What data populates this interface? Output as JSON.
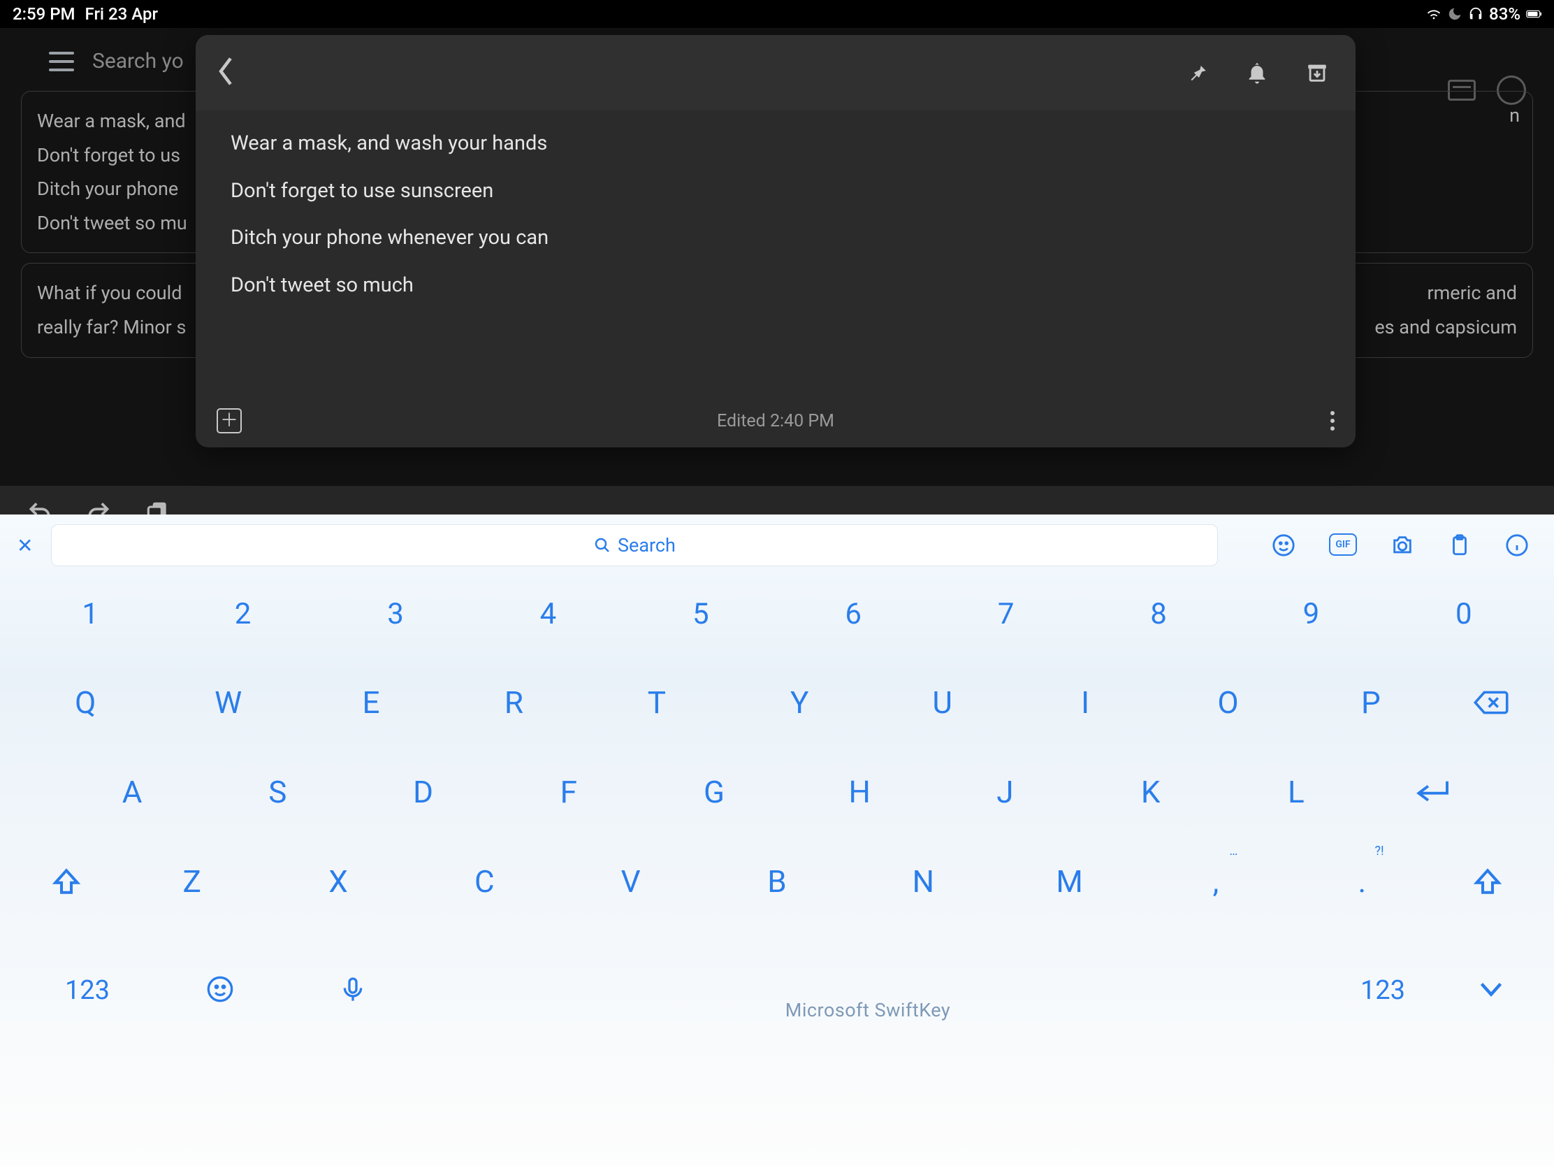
{
  "status": {
    "time": "2:59 PM",
    "date": "Fri 23 Apr",
    "battery_pct": "83%"
  },
  "bg": {
    "search_placeholder": "Search yo",
    "note1": {
      "l1": "Wear a mask, and",
      "l2": "Don't forget to us",
      "l3": "Ditch your phone",
      "l4": "Don't tweet so mu"
    },
    "note1_right": "n",
    "note2_left": "What if you could\nreally far? Minor s",
    "note2_right": "rmeric and\nes and capsicum"
  },
  "note": {
    "lines": [
      "Wear a mask, and wash your hands",
      "Don't forget to use sunscreen",
      "Ditch your phone whenever you can",
      "Don't tweet so much"
    ],
    "edited": "Edited 2:40 PM"
  },
  "keyboard": {
    "search_label": "Search",
    "rows": {
      "num": [
        "1",
        "2",
        "3",
        "4",
        "5",
        "6",
        "7",
        "8",
        "9",
        "0"
      ],
      "r1": [
        "Q",
        "W",
        "E",
        "R",
        "T",
        "Y",
        "U",
        "I",
        "O",
        "P"
      ],
      "r2": [
        "A",
        "S",
        "D",
        "F",
        "G",
        "H",
        "J",
        "K",
        "L"
      ],
      "r3": [
        "Z",
        "X",
        "C",
        "V",
        "B",
        "N",
        "M",
        ",",
        "."
      ]
    },
    "sup_comma": "…",
    "sup_period": "?!",
    "mode_label": "123",
    "brand": "Microsoft SwiftKey",
    "gif_label": "GIF"
  }
}
